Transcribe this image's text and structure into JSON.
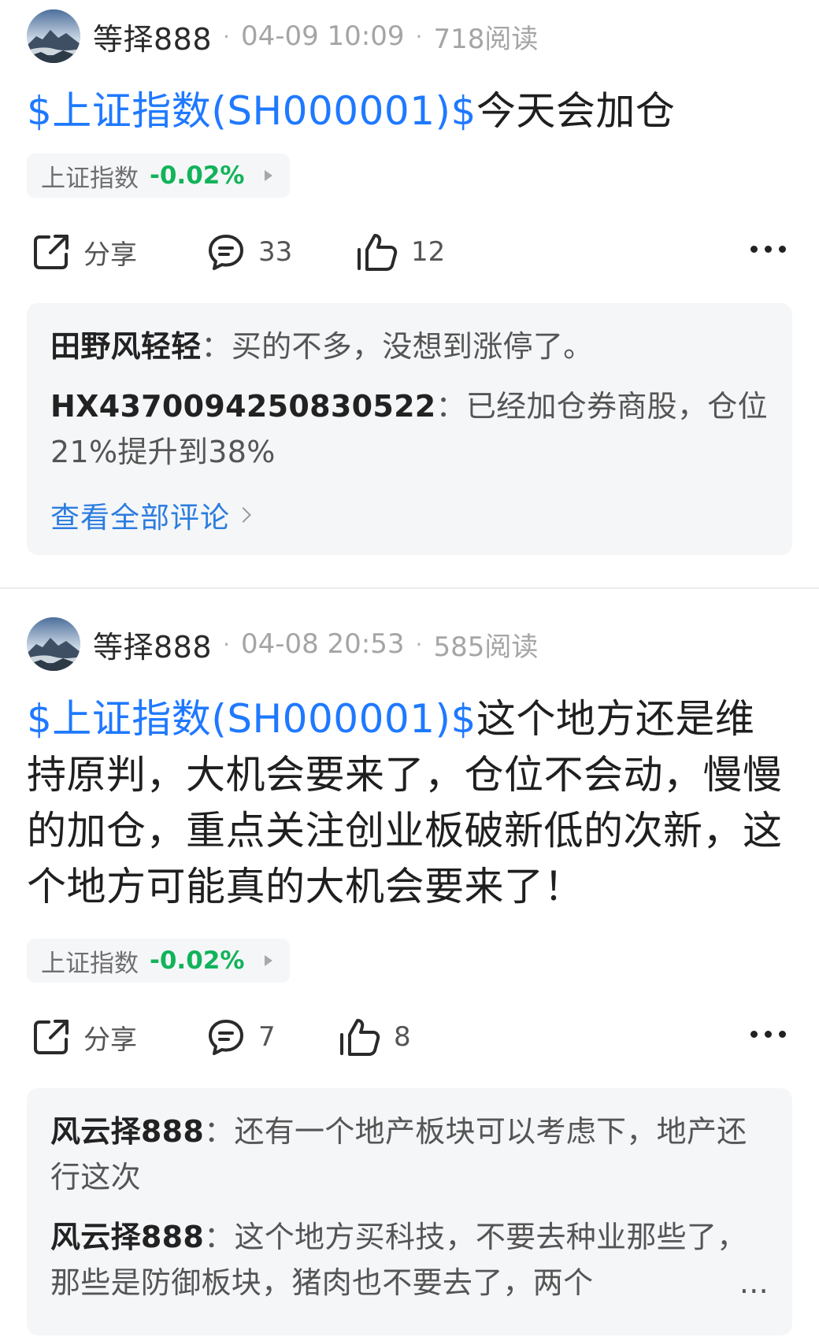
{
  "posts": [
    {
      "author": "等择888",
      "date": "04-09 10:09",
      "reads": "718阅读",
      "stock_tag": "$上证指数(SH000001)$",
      "text": "今天会加仓",
      "chip": {
        "name": "上证指数",
        "change": "-0.02%"
      },
      "actions": {
        "share": "分享",
        "comments": "33",
        "likes": "12"
      },
      "comments": [
        {
          "author": "田野风轻轻",
          "text": "买的不多，没想到涨停了。"
        },
        {
          "author": "HX4370094250830522",
          "text": "已经加仓券商股，仓位21%提升到38%"
        }
      ],
      "view_all": "查看全部评论"
    },
    {
      "author": "等择888",
      "date": "04-08 20:53",
      "reads": "585阅读",
      "stock_tag": "$上证指数(SH000001)$",
      "text": "这个地方还是维持原判，大机会要来了，仓位不会动，慢慢的加仓，重点关注创业板破新低的次新，这个地方可能真的大机会要来了！",
      "chip": {
        "name": "上证指数",
        "change": "-0.02%"
      },
      "actions": {
        "share": "分享",
        "comments": "7",
        "likes": "8"
      },
      "comments": [
        {
          "author": "风云择888",
          "text": "还有一个地产板块可以考虑下，地产还行这次"
        },
        {
          "author": "风云择888",
          "text": "这个地方买科技，不要去种业那些了，那些是防御板块，猪肉也不要去了，两个"
        }
      ],
      "ellipsis": "..."
    }
  ],
  "colors": {
    "link_blue": "#1f79ff",
    "change_green": "#12b35a",
    "view_all_blue": "#2b7de0",
    "comment_bg": "#f5f6f8"
  },
  "icons": [
    "share-icon",
    "comment-icon",
    "like-icon",
    "more-icon",
    "chevron-right-icon"
  ]
}
